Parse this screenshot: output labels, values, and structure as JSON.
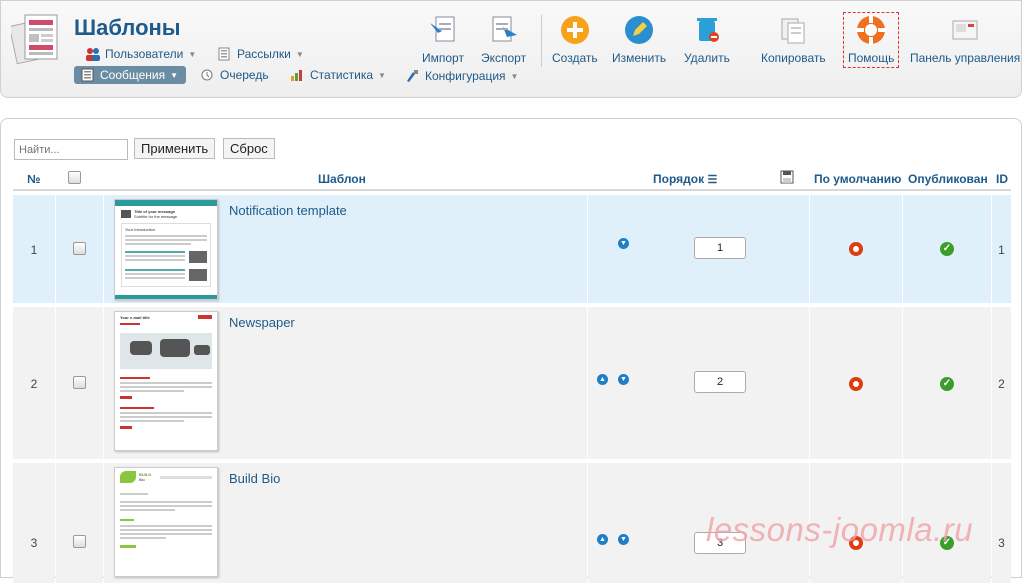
{
  "header": {
    "title": "Шаблоны",
    "nav": {
      "users": "Пользователи",
      "mailings": "Рассылки",
      "messages": "Сообщения",
      "queue": "Очередь",
      "statistics": "Статистика",
      "config": "Конфигурация"
    },
    "toolbar": {
      "import": "Импорт",
      "export": "Экспорт",
      "create": "Создать",
      "edit": "Изменить",
      "delete": "Удалить",
      "copy": "Копировать",
      "help": "Помощь",
      "control_panel": "Панель управления"
    }
  },
  "filter": {
    "placeholder": "Найти...",
    "apply": "Применить",
    "reset": "Сброс"
  },
  "table": {
    "columns": {
      "num": "№",
      "template": "Шаблон",
      "order": "Порядок",
      "default": "По умолчанию",
      "published": "Опубликован",
      "id": "ID"
    },
    "rows": [
      {
        "num": "1",
        "name": "Notification template",
        "order": "1",
        "id": "1",
        "default": false,
        "published": true,
        "arrows": [
          "down"
        ]
      },
      {
        "num": "2",
        "name": "Newspaper",
        "order": "2",
        "id": "2",
        "default": false,
        "published": true,
        "arrows": [
          "up",
          "down"
        ]
      },
      {
        "num": "3",
        "name": "Build Bio",
        "order": "3",
        "id": "3",
        "default": false,
        "published": true,
        "arrows": [
          "up",
          "down"
        ]
      }
    ]
  },
  "thumbnails": {
    "row1": {
      "heading": "Title of your message",
      "subheading": "Subtitle for the message",
      "section": "Your Introduction"
    },
    "row2": {
      "heading": "Your e-mail title"
    },
    "row3": {
      "heading": "BUILD",
      "subheading": "Bio"
    }
  },
  "watermark": "lessons-joomla.ru",
  "colors": {
    "link": "#1e5a8a",
    "selected_row": "#dff0fa",
    "row_bg": "#f2f2f2",
    "published": "#3a9e28",
    "not_default": "#dd3d10",
    "arrow": "#1f7fc4"
  }
}
